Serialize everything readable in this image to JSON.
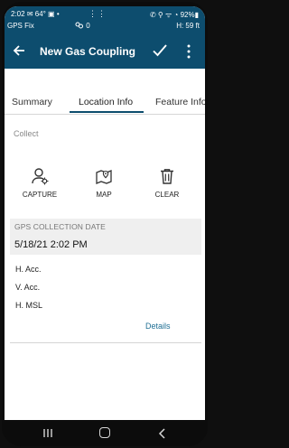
{
  "status_bar": {
    "time": "2:02",
    "left_icons": "✉ 64° ▣ •",
    "center_icons": "⋮⋮",
    "right_text": "✆ ⚲ ᯤ ◔ 92%▮",
    "gps_status": "GPS Fix",
    "satellites": "0",
    "height": "H: 59 ft"
  },
  "app_bar": {
    "title": "New Gas Coupling",
    "back_icon": "arrow-left-icon",
    "confirm_icon": "check-icon",
    "more_icon": "more-vertical-icon"
  },
  "tabs": [
    {
      "label": "Summary",
      "active": false
    },
    {
      "label": "Location Info",
      "active": true
    },
    {
      "label": "Feature Info",
      "active": false
    }
  ],
  "collect": {
    "label": "Collect",
    "actions": [
      {
        "label": "CAPTURE",
        "icon": "person-pin-icon"
      },
      {
        "label": "MAP",
        "icon": "map-pin-icon"
      },
      {
        "label": "CLEAR",
        "icon": "trash-icon"
      }
    ]
  },
  "gps_collection": {
    "header": "GPS COLLECTION DATE",
    "value": "5/18/21 2:02 PM"
  },
  "accuracy": [
    {
      "label": "H. Acc."
    },
    {
      "label": "V. Acc."
    },
    {
      "label": "H. MSL"
    }
  ],
  "details_link": "Details",
  "colors": {
    "brand": "#0d4d6e",
    "link": "#1f6f94"
  }
}
